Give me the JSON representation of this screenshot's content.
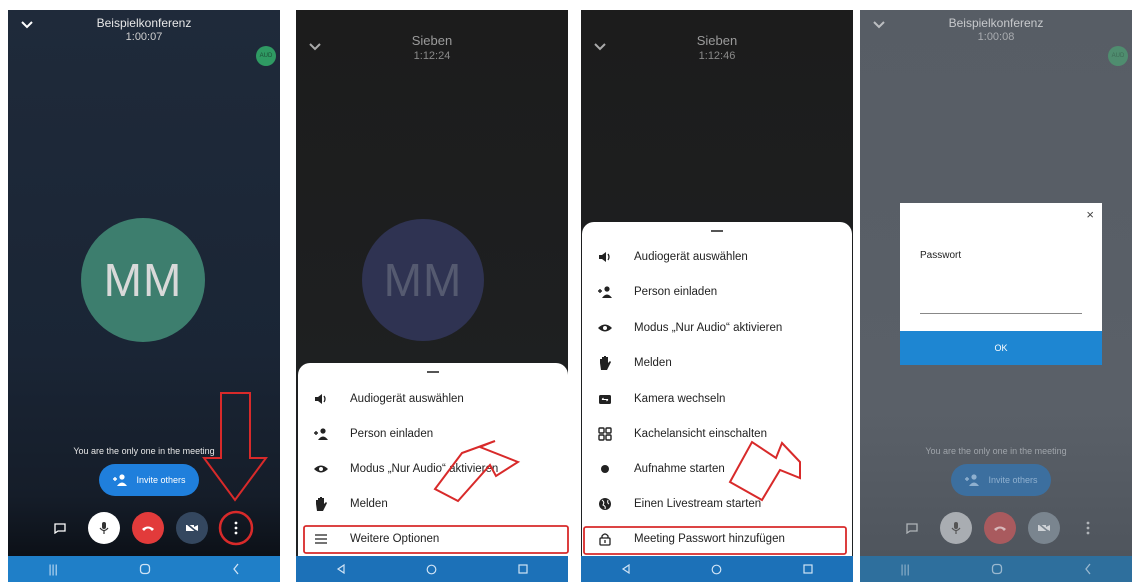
{
  "screen1": {
    "title": "Beispielkonferenz",
    "time": "1:00:07",
    "audio_badge": "AUD",
    "avatar_initials": "MM",
    "only_one_text": "You are the only one in the meeting",
    "invite_label": "Invite others"
  },
  "screen2": {
    "title": "Sieben",
    "time": "1:12:24",
    "avatar_initials": "MM",
    "menu": [
      {
        "label": "Audiogerät auswählen",
        "icon": "speaker-icon"
      },
      {
        "label": "Person einladen",
        "icon": "add-person-icon"
      },
      {
        "label": "Modus „Nur Audio“ aktivieren",
        "icon": "eye-icon"
      },
      {
        "label": "Melden",
        "icon": "hand-icon"
      },
      {
        "label": "Weitere Optionen",
        "icon": "menu-icon"
      }
    ]
  },
  "screen3": {
    "title": "Sieben",
    "time": "1:12:46",
    "menu": [
      {
        "label": "Audiogerät auswählen",
        "icon": "speaker-icon"
      },
      {
        "label": "Person einladen",
        "icon": "add-person-icon"
      },
      {
        "label": "Modus „Nur Audio“ aktivieren",
        "icon": "eye-icon"
      },
      {
        "label": "Melden",
        "icon": "hand-icon"
      },
      {
        "label": "Kamera wechseln",
        "icon": "switch-camera-icon"
      },
      {
        "label": "Kachelansicht einschalten",
        "icon": "tile-view-icon"
      },
      {
        "label": "Aufnahme starten",
        "icon": "record-icon"
      },
      {
        "label": "Einen Livestream starten",
        "icon": "globe-icon"
      },
      {
        "label": "Meeting Passwort hinzufügen",
        "icon": "lock-icon"
      }
    ]
  },
  "screen4": {
    "title": "Beispielkonferenz",
    "time": "1:00:08",
    "audio_badge": "AUD",
    "dialog_close": "×",
    "password_label": "Passwort",
    "ok_label": "OK",
    "only_one_text": "You are the only one in the meeting",
    "invite_label": "Invite others"
  },
  "colors": {
    "accent_blue": "#1f7fdc",
    "hangup_red": "#e23b3b",
    "highlight_red": "#d82a2a",
    "nav_blue": "#1f7fc8",
    "avatar_green": "#3d7e6e"
  }
}
